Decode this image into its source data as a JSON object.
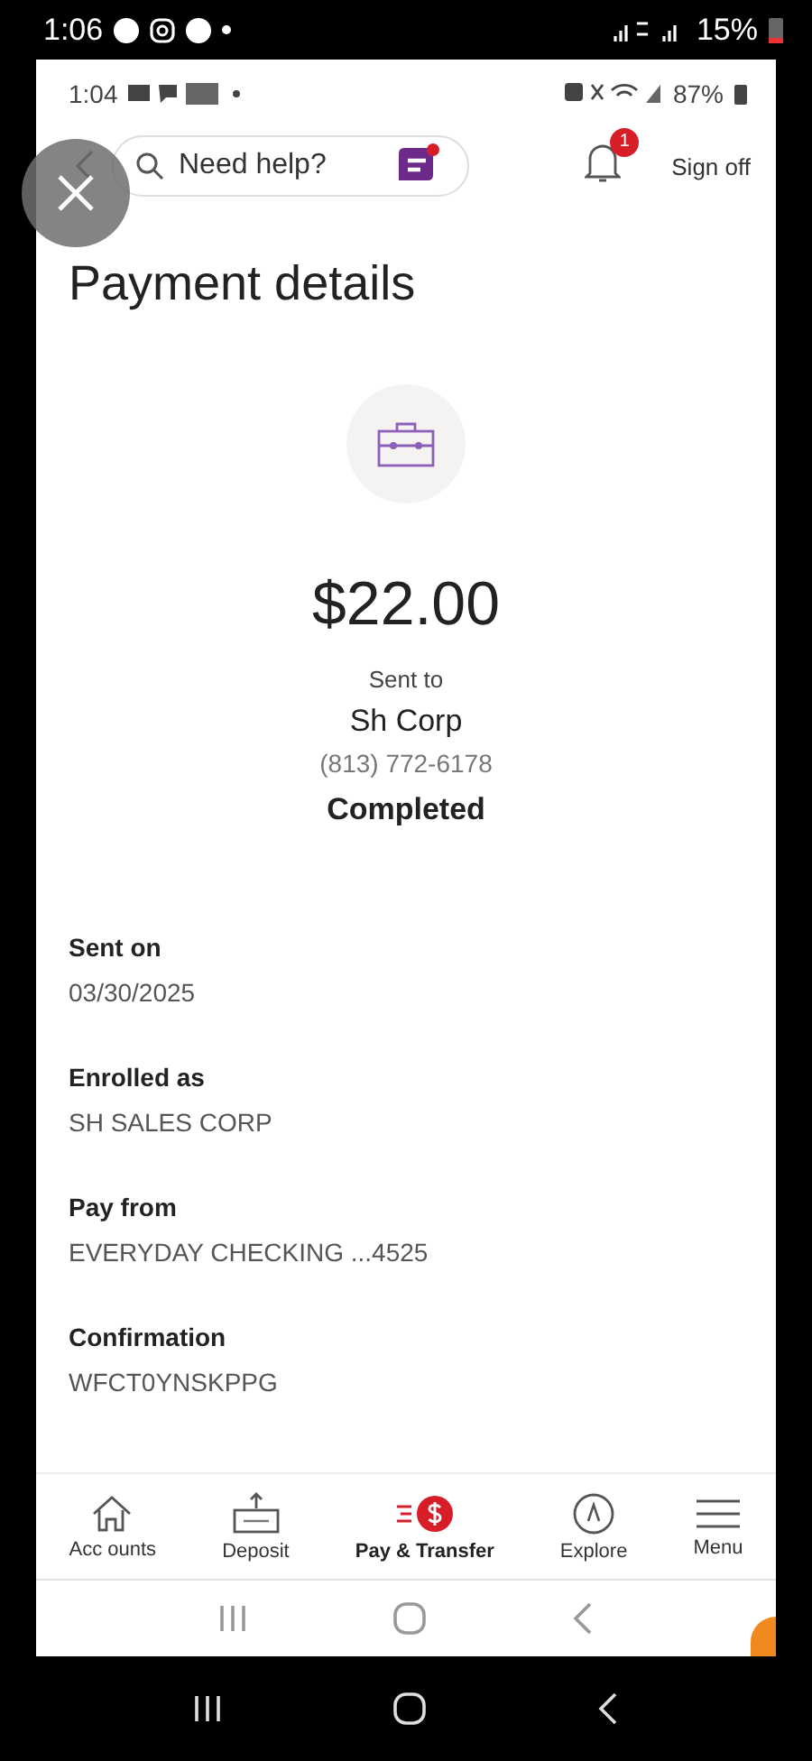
{
  "outer_status_bar": {
    "time": "1:06",
    "battery": "15%"
  },
  "inner_status_bar": {
    "time": "1:04",
    "battery": "87%"
  },
  "header": {
    "search": {
      "placeholder": "Need help?"
    },
    "notifications": {
      "count": "1"
    },
    "sign_off": "Sign off"
  },
  "title": "Payment details",
  "payment": {
    "amount": "$22.00",
    "sent_to_label": "Sent to",
    "recipient": "Sh Corp",
    "phone": "(813) 772-6178",
    "status": "Completed"
  },
  "details": [
    {
      "label": "Sent on",
      "value": "03/30/2025"
    },
    {
      "label": "Enrolled as",
      "value": "SH SALES CORP"
    },
    {
      "label": "Pay from",
      "value": "EVERYDAY CHECKING ...4525"
    },
    {
      "label": "Confirmation",
      "value": "WFCT0YNSKPPG"
    }
  ],
  "tab_bar": [
    {
      "kind": "accounts",
      "label": "Acc ounts",
      "selected": false
    },
    {
      "kind": "deposit",
      "label": "Deposit",
      "selected": false
    },
    {
      "kind": "pay",
      "label": "Pay & Transfer",
      "selected": true
    },
    {
      "kind": "explore",
      "label": "Explore",
      "selected": false
    },
    {
      "kind": "menu",
      "label": "Menu",
      "selected": false
    }
  ]
}
